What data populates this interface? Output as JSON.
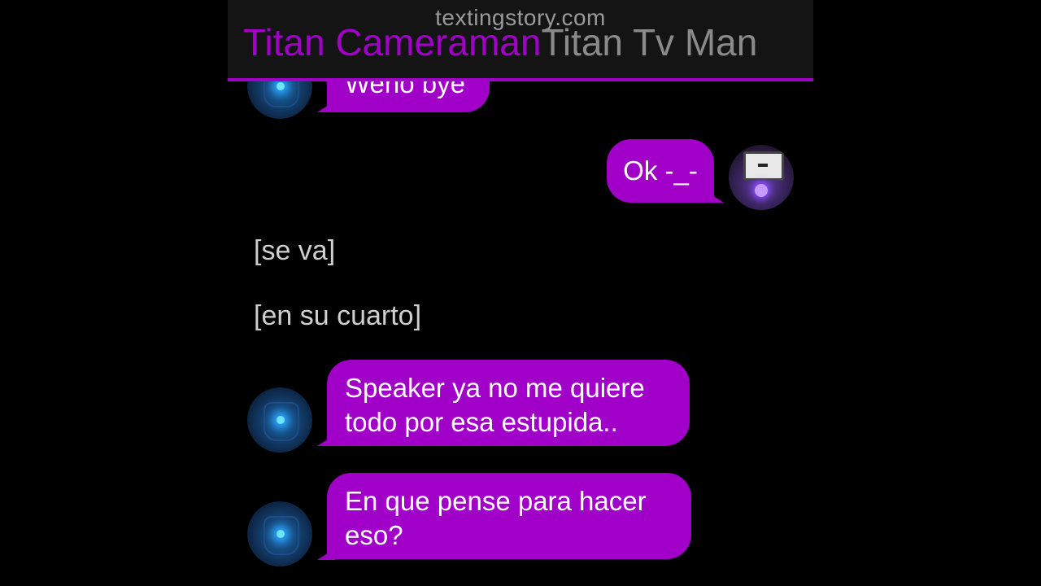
{
  "watermark": "textingstory.com",
  "header": {
    "contact_a": "Titan Cameraman",
    "contact_b": "Titan Tv Man"
  },
  "colors": {
    "accent": "#a000c8",
    "background": "#000000",
    "header_bg": "#141414",
    "narration_text": "#cfcfcf"
  },
  "messages": [
    {
      "sender": "Titan Cameraman",
      "side": "left",
      "text": "Weno bye",
      "avatar": "titan-cameraman-avatar"
    },
    {
      "sender": "Titan Tv Man",
      "side": "right",
      "text": "Ok -_-",
      "avatar": "titan-tvman-avatar"
    },
    {
      "type": "narration",
      "text": "[se va]"
    },
    {
      "type": "narration",
      "text": "[en su cuarto]"
    },
    {
      "sender": "Titan Cameraman",
      "side": "left",
      "text_lines": [
        "Speaker ya no me quiere",
        "todo por esa estupida.."
      ],
      "avatar": "titan-cameraman-avatar"
    },
    {
      "sender": "Titan Cameraman",
      "side": "left",
      "text_lines": [
        "En que pense para hacer",
        "eso?"
      ],
      "avatar": "titan-cameraman-avatar"
    }
  ]
}
